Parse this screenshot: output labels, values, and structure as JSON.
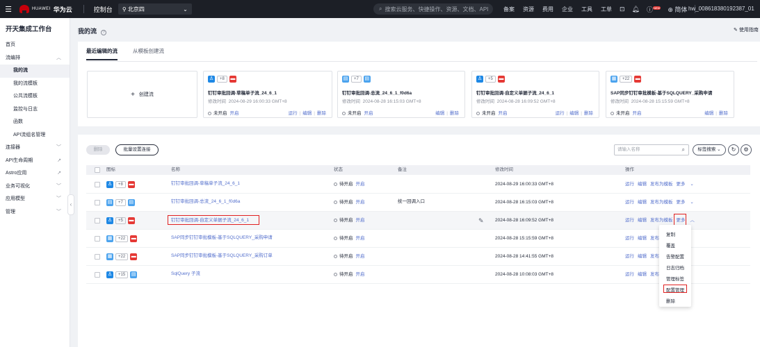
{
  "topbar": {
    "brand_small": "HUAWEI",
    "brand_name": "华为云",
    "console": "控制台",
    "region": "北京四",
    "search_placeholder": "搜索云服务、快捷操作、资源、文档、API",
    "nav": [
      "备案",
      "资源",
      "费用",
      "企业",
      "工具",
      "工单"
    ],
    "new_badge": "NEW",
    "lang": "简体",
    "user": "hw_008618380192387_01"
  },
  "sidebar": {
    "title": "开天集成工作台",
    "items": [
      {
        "label": "首页"
      },
      {
        "label": "流编排"
      },
      {
        "label": "我的流"
      },
      {
        "label": "我的流模板"
      },
      {
        "label": "公共流模板"
      },
      {
        "label": "监控与日志"
      },
      {
        "label": "函数"
      },
      {
        "label": "API流组名管理"
      },
      {
        "label": "连接器"
      },
      {
        "label": "API生命周期"
      },
      {
        "label": "Astro应用"
      },
      {
        "label": "业务可视化"
      },
      {
        "label": "应用模型"
      },
      {
        "label": "管理"
      }
    ]
  },
  "page": {
    "title": "我的流",
    "guide": "使用指南"
  },
  "recent": {
    "tabs": [
      "最近编辑的流",
      "从模板创建流"
    ],
    "create_label": "创建流",
    "time_prefix": "修改时间",
    "cards": [
      {
        "count": "+8",
        "title": "钉钉审批回调-草稿单子流_24_6_1",
        "time": "2024-08-29 16:00:33 GMT+8",
        "status": "未开启",
        "enable": "开启",
        "ops": [
          "运行",
          "编辑",
          "删除"
        ]
      },
      {
        "count": "+7",
        "title": "钉钉审批回调-总流_24_6_1_f0d6a",
        "time": "2024-08-28 16:15:03 GMT+8",
        "status": "未开启",
        "enable": "开启",
        "ops": [
          "编辑",
          "删除"
        ]
      },
      {
        "count": "+5",
        "title": "钉钉审批回调-自定义单据子流_24_6_1",
        "time": "2024-08-28 16:09:52 GMT+8",
        "status": "未开启",
        "enable": "开启",
        "ops": [
          "运行",
          "编辑",
          "删除"
        ]
      },
      {
        "count": "+22",
        "title": "SAP同步钉钉审批模板-基于SQLQUERY_采购申请",
        "time": "2024-08-28 15:15:59 GMT+8",
        "status": "未开启",
        "enable": "开启",
        "ops": [
          "编辑",
          "删除"
        ]
      }
    ]
  },
  "toolbar": {
    "delete": "删除",
    "batch": "批量设置连接",
    "search_placeholder": "请输入名称",
    "tag_search": "标签搜索"
  },
  "table": {
    "headers": [
      "图标",
      "名称",
      "状态",
      "备注",
      "修改时间",
      "操作"
    ],
    "rows": [
      {
        "count": "+8",
        "name": "钉钉审批回调-草稿单子流_24_6_1",
        "status": "待开启",
        "enable": "开启",
        "note": "",
        "time": "2024-08-29 16:00:33 GMT+8",
        "ops": [
          "运行",
          "编辑",
          "发布为模板",
          "更多"
        ]
      },
      {
        "count": "+7",
        "name": "钉钉审批回调-总流_24_6_1_f0d6a",
        "status": "待开启",
        "enable": "开启",
        "note": "统一回调入口",
        "time": "2024-08-28 16:15:03 GMT+8",
        "ops": [
          "运行",
          "编辑",
          "发布为模板",
          "更多"
        ]
      },
      {
        "count": "+5",
        "name": "钉钉审批回调-自定义单据子流_24_6_1",
        "status": "待开启",
        "enable": "开启",
        "note": "",
        "time": "2024-08-28 16:09:52 GMT+8",
        "ops": [
          "运行",
          "编辑",
          "发布为模板",
          "更多"
        ]
      },
      {
        "count": "+22",
        "name": "SAP同步钉钉审批模板-基于SQLQUERY_采购申请",
        "status": "待开启",
        "enable": "开启",
        "note": "",
        "time": "2024-08-28 15:15:59 GMT+8",
        "ops": [
          "运行",
          "编辑",
          "发布"
        ]
      },
      {
        "count": "+22",
        "name": "SAP同步钉钉审批模板-基于SQLQUERY_采购订单",
        "status": "待开启",
        "enable": "开启",
        "note": "",
        "time": "2024-08-28 14:41:55 GMT+8",
        "ops": [
          "运行",
          "编辑",
          "发布"
        ]
      },
      {
        "count": "+15",
        "name": "SqlQuery 子流",
        "status": "待开启",
        "enable": "开启",
        "note": "",
        "time": "2024-08-28 10:08:03 GMT+8",
        "ops": [
          "运行",
          "编辑",
          "发布"
        ]
      }
    ]
  },
  "dropdown": {
    "items": [
      "复制",
      "覆盖",
      "告警配置",
      "日志归档",
      "管理标签",
      "配置管理",
      "删除"
    ]
  }
}
